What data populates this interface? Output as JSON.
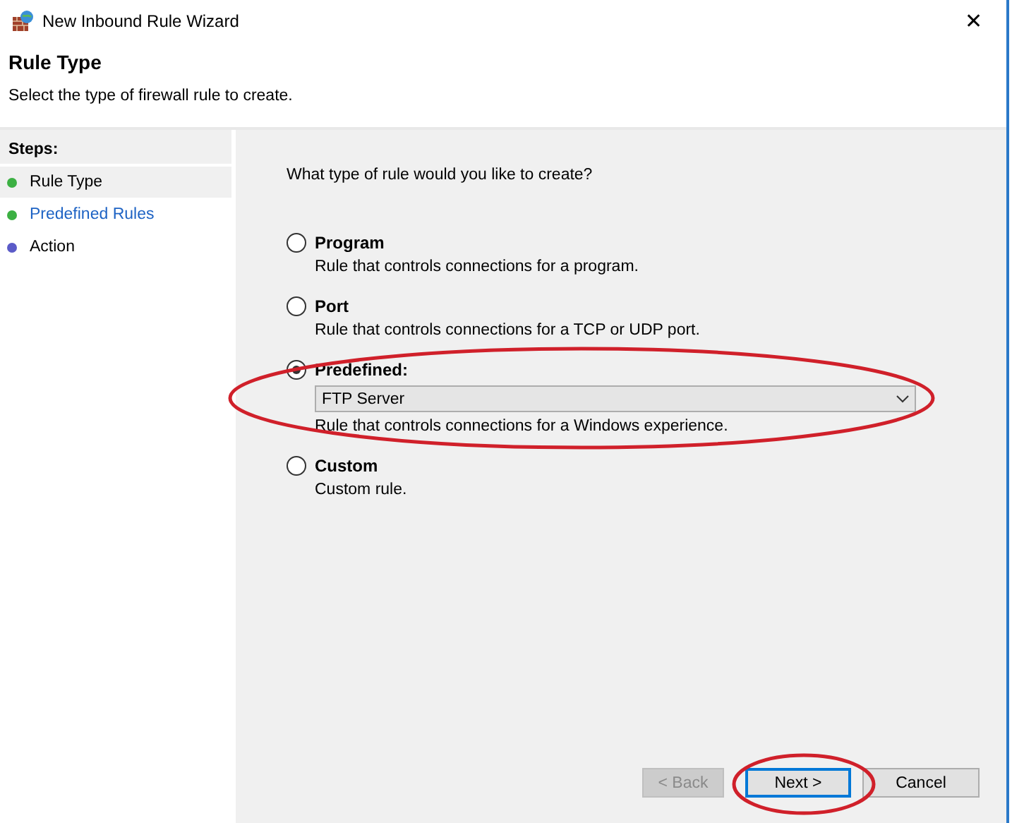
{
  "window": {
    "title": "New Inbound Rule Wizard",
    "close": "✕"
  },
  "header": {
    "title": "Rule Type",
    "subtitle": "Select the type of firewall rule to create."
  },
  "steps": {
    "heading": "Steps:",
    "items": [
      {
        "label": "Rule Type",
        "selected": true,
        "color": "#3cb043"
      },
      {
        "label": "Predefined Rules",
        "selected": false,
        "color": "#3cb043"
      },
      {
        "label": "Action",
        "selected": false,
        "color": "#5b5bc8"
      }
    ]
  },
  "question": "What type of rule would you like to create?",
  "options": [
    {
      "label": "Program",
      "description": "Rule that controls connections for a program.",
      "selected": false
    },
    {
      "label": "Port",
      "description": "Rule that controls connections for a TCP or UDP port.",
      "selected": false
    },
    {
      "label": "Predefined:",
      "description": "Rule that controls connections for a Windows experience.",
      "selected": true,
      "annotated": true,
      "dropdown": {
        "value": "FTP Server"
      }
    },
    {
      "label": "Custom",
      "description": "Custom rule.",
      "selected": false
    }
  ],
  "buttons": [
    {
      "label": "< Back",
      "disabled": true,
      "focused": false
    },
    {
      "label": "Next >",
      "disabled": false,
      "focused": true,
      "annotated": true
    },
    {
      "label": "Cancel",
      "disabled": false,
      "focused": false
    }
  ]
}
